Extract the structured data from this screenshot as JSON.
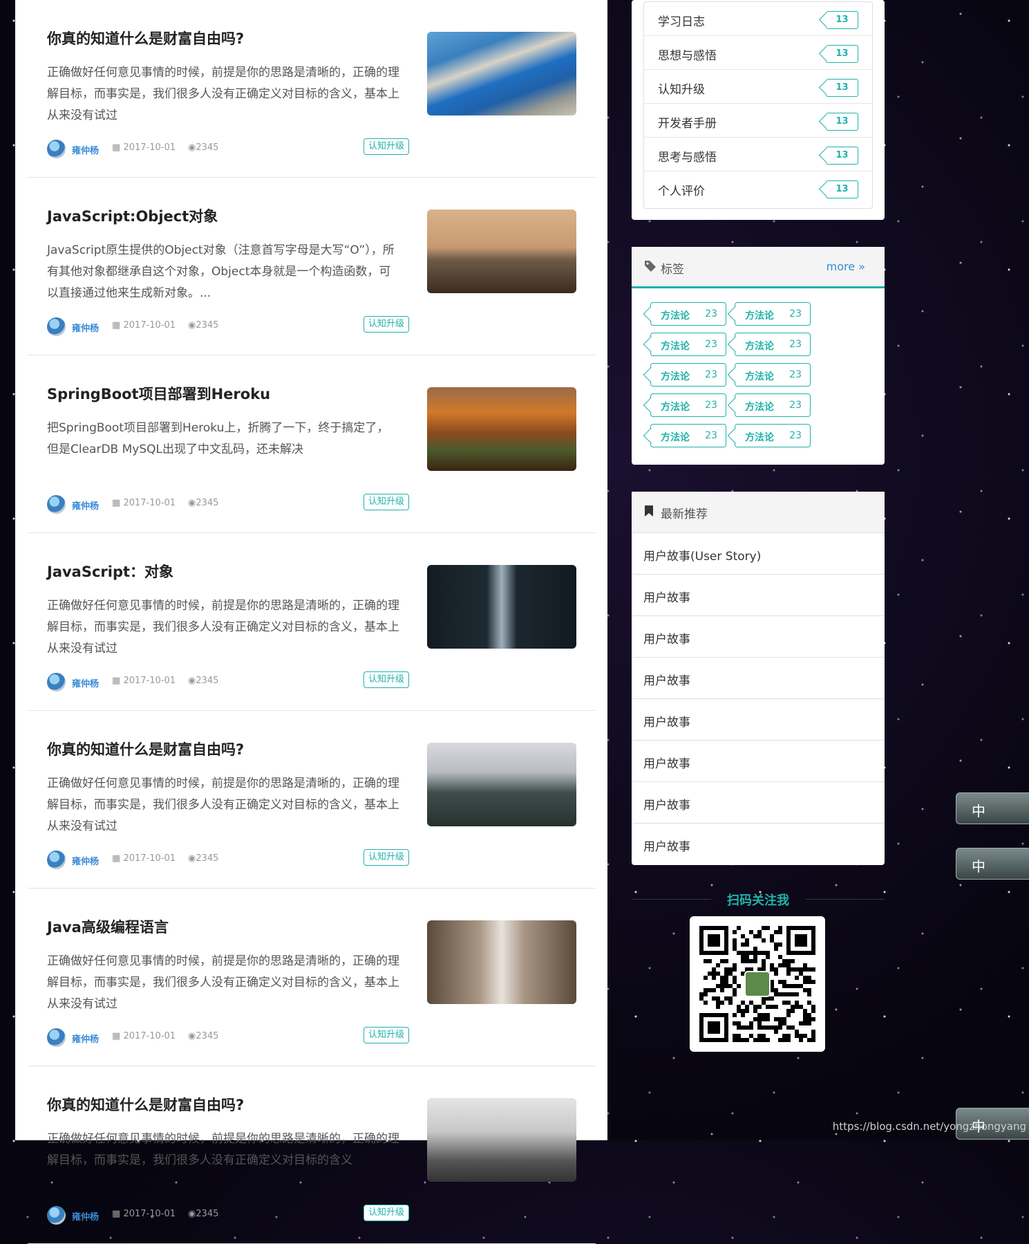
{
  "articles": [
    {
      "title": "你真的知道什么是财富自由吗?",
      "excerpt": "正确做好任何意见事情的时候，前提是你的思路是清晰的，正确的理解目标，而事实是，我们很多人没有正确定义对目标的含义，基本上从来没有试过",
      "author": "雍仲杨",
      "date": "2017-10-01",
      "views": "2345",
      "category": "认知升级",
      "thumb": "fjord"
    },
    {
      "title": "JavaScript:Object对象",
      "excerpt": "JavaScript原生提供的Object对象（注意首写字母是大写“O”），所有其他对象都继承自这个对象，Object本身就是一个构造函数，可以直接通过他来生成新对象。...",
      "author": "雍仲杨",
      "date": "2017-10-01",
      "views": "2345",
      "category": "认知升级",
      "thumb": "person"
    },
    {
      "title": "SpringBoot项目部署到Heroku",
      "excerpt": "把SpringBoot项目部署到Heroku上，折腾了一下，终于搞定了，但是ClearDB MySQL出现了中文乱码，还未解决",
      "author": "雍仲杨",
      "date": "2017-10-01",
      "views": "2345",
      "category": "认知升级",
      "thumb": "canyon"
    },
    {
      "title": "JavaScript：对象",
      "excerpt": "正确做好任何意见事情的时候，前提是你的思路是清晰的，正确的理解目标，而事实是，我们很多人没有正确定义对目标的含义，基本上从来没有试过",
      "author": "雍仲杨",
      "date": "2017-10-01",
      "views": "2345",
      "category": "认知升级",
      "thumb": "tower"
    },
    {
      "title": "你真的知道什么是财富自由吗?",
      "excerpt": "正确做好任何意见事情的时候，前提是你的思路是清晰的，正确的理解目标，而事实是，我们很多人没有正确定义对目标的含义，基本上从来没有试过",
      "author": "雍仲杨",
      "date": "2017-10-01",
      "views": "2345",
      "category": "认知升级",
      "thumb": "mountain"
    },
    {
      "title": "Java高级编程语言",
      "excerpt": "正确做好任何意见事情的时候，前提是你的思路是清晰的，正确的理解目标，而事实是，我们很多人没有正确定义对目标的含义，基本上从来没有试过",
      "author": "雍仲杨",
      "date": "2017-10-01",
      "views": "2345",
      "category": "认知升级",
      "thumb": "waterfall"
    },
    {
      "title": "你真的知道什么是财富自由吗?",
      "excerpt": "正确做好任何意见事情的时候，前提是你的思路是清晰的，正确的理解目标，而事实是，我们很多人没有正确定义对目标的含义",
      "author": "雍仲杨",
      "date": "2017-10-01",
      "views": "2345",
      "category": "认知升级",
      "thumb": "hills"
    }
  ],
  "categories": [
    {
      "label": "学习日志",
      "count": "13"
    },
    {
      "label": "思想与感悟",
      "count": "13"
    },
    {
      "label": "认知升级",
      "count": "13"
    },
    {
      "label": "开发者手册",
      "count": "13"
    },
    {
      "label": "思考与感悟",
      "count": "13"
    },
    {
      "label": "个人评价",
      "count": "13"
    }
  ],
  "tags_widget": {
    "title": "标签",
    "more_label": "more",
    "tags": [
      {
        "name": "方法论",
        "count": "23"
      },
      {
        "name": "方法论",
        "count": "23"
      },
      {
        "name": "方法论",
        "count": "23"
      },
      {
        "name": "方法论",
        "count": "23"
      },
      {
        "name": "方法论",
        "count": "23"
      },
      {
        "name": "方法论",
        "count": "23"
      },
      {
        "name": "方法论",
        "count": "23"
      },
      {
        "name": "方法论",
        "count": "23"
      },
      {
        "name": "方法论",
        "count": "23"
      },
      {
        "name": "方法论",
        "count": "23"
      }
    ]
  },
  "recommend_widget": {
    "title": "最新推荐",
    "items": [
      "用户故事(User Story)",
      "用户故事",
      "用户故事",
      "用户故事",
      "用户故事",
      "用户故事",
      "用户故事",
      "用户故事"
    ]
  },
  "qr": {
    "title": "扫码关注我"
  },
  "footer": {
    "url": "https://blog.csdn.net/yongzhongyang"
  },
  "float_buttons": {
    "label": "中"
  },
  "colors": {
    "accent": "#20b2aa",
    "link": "#3a8ad6",
    "background": "#06040d"
  }
}
